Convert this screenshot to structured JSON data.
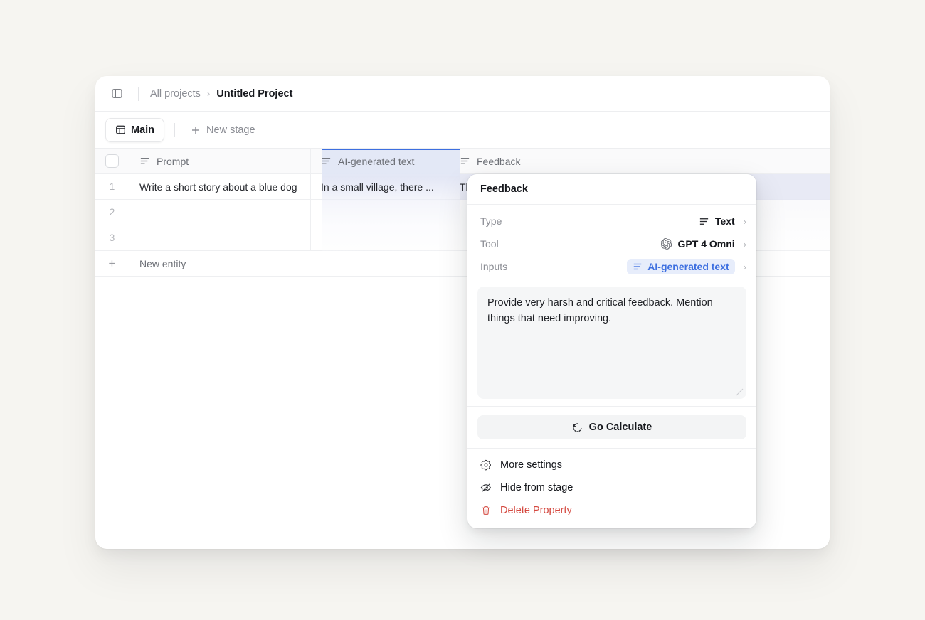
{
  "topbar": {
    "sidebar_toggle_icon": "panel-toggle-icon",
    "breadcrumb_root": "All projects",
    "breadcrumb_separator": "›",
    "breadcrumb_current": "Untitled Project"
  },
  "stagebar": {
    "tab_label": "Main",
    "tab_icon": "table-icon",
    "new_stage_label": "New stage",
    "new_stage_icon": "plus-icon"
  },
  "table": {
    "columns": [
      {
        "label": "Prompt",
        "icon": "text-lines-icon"
      },
      {
        "label": "AI-generated text",
        "icon": "text-lines-icon"
      },
      {
        "label": "Feedback",
        "icon": "text-lines-icon"
      }
    ],
    "rows": [
      {
        "num": "1",
        "prompt": "Write a short story about a blue dog",
        "ai": "In a small village, there ...",
        "feedback": "The story about the blue dog is ..."
      },
      {
        "num": "2",
        "prompt": "",
        "ai": "",
        "feedback": ""
      },
      {
        "num": "3",
        "prompt": "",
        "ai": "",
        "feedback": ""
      }
    ],
    "new_entity_label": "New entity",
    "new_entity_icon": "plus-icon",
    "selected_column": "AI-generated text"
  },
  "popup": {
    "title": "Feedback",
    "properties": [
      {
        "label": "Type",
        "value": "Text",
        "icon": "text-lines-icon",
        "style": "plain"
      },
      {
        "label": "Tool",
        "value": "GPT 4 Omni",
        "icon": "openai-icon",
        "style": "plain"
      },
      {
        "label": "Inputs",
        "value": "AI-generated text",
        "icon": "text-lines-icon",
        "style": "badge"
      }
    ],
    "prompt_text": "Provide very harsh and critical feedback. Mention things that need improving.",
    "calculate_label": "Go Calculate",
    "calculate_icon": "refresh-icon",
    "menu": [
      {
        "label": "More settings",
        "icon": "gear-icon",
        "danger": false
      },
      {
        "label": "Hide from stage",
        "icon": "eye-off-icon",
        "danger": false
      },
      {
        "label": "Delete Property",
        "icon": "trash-icon",
        "danger": true
      }
    ]
  },
  "colors": {
    "page_background": "#f6f5f1",
    "accent_blue": "#3d6fe0",
    "danger_red": "#d4483f",
    "selection_tint": "#e2e7f6"
  }
}
